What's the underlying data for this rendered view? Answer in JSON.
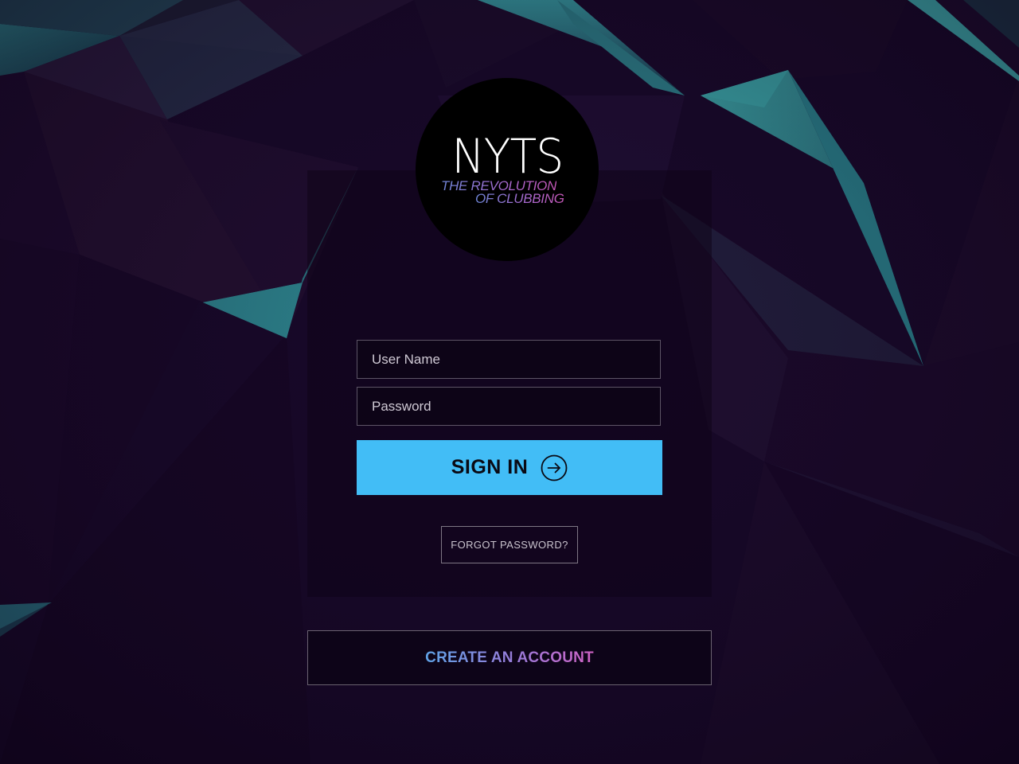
{
  "colors": {
    "background": "#14061f",
    "accent_teal": "#3fb7b4",
    "signin_button": "#42bdf6",
    "tagline_gradient": [
      "#6f86d8",
      "#c456b6"
    ],
    "create_gradient": [
      "#5fa2e6",
      "#cf62c4"
    ]
  },
  "logo": {
    "title": "NYTS",
    "tagline_line1": "THE REVOLUTION",
    "tagline_line2": "OF CLUBBING"
  },
  "form": {
    "username_placeholder": "User Name",
    "username_value": "",
    "password_placeholder": "Password",
    "password_value": "",
    "signin_label": "SIGN IN",
    "signin_icon": "arrow-right-circle-icon",
    "forgot_label": "FORGOT PASSWORD?"
  },
  "footer": {
    "create_account_label": "CREATE AN ACCOUNT"
  }
}
